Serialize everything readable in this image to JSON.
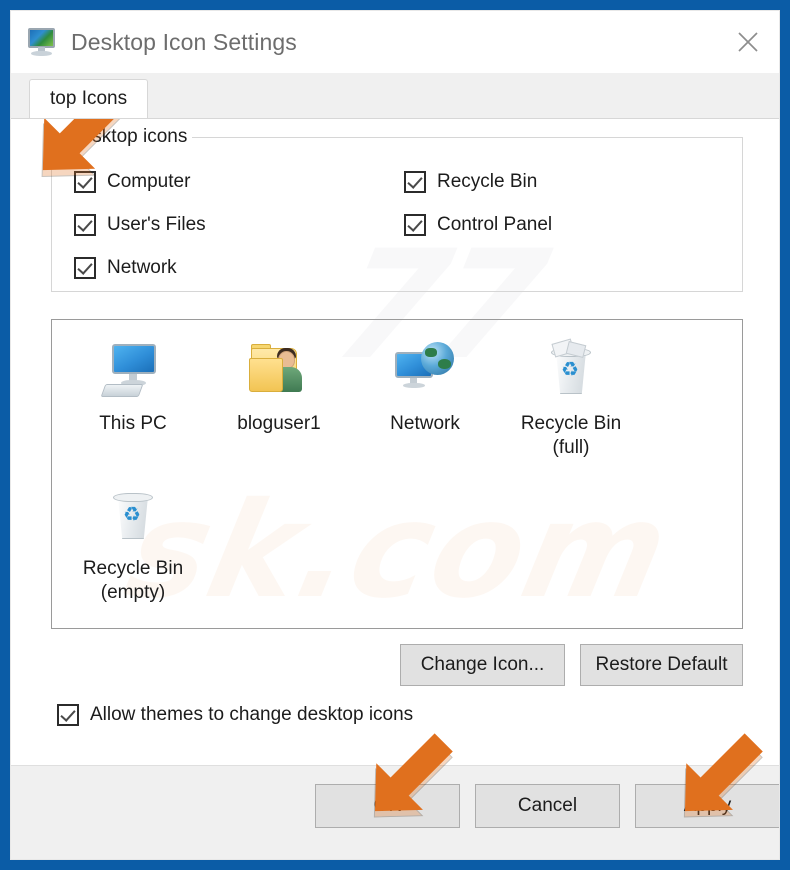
{
  "window": {
    "title": "Desktop Icon Settings",
    "icon": "display-monitor-icon",
    "close_label": "✕",
    "frame_color": "#0b5ca6"
  },
  "tabs": [
    {
      "label": "Desktop Icons",
      "visible_label": "top Icons",
      "selected": true
    }
  ],
  "groupbox": {
    "legend": "Desktop icons",
    "checkboxes": [
      {
        "label": "Computer",
        "checked": true,
        "column": "left"
      },
      {
        "label": "Recycle Bin",
        "checked": true,
        "column": "right"
      },
      {
        "label": "User's Files",
        "checked": true,
        "column": "left"
      },
      {
        "label": "Control Panel",
        "checked": true,
        "column": "right"
      },
      {
        "label": "Network",
        "checked": true,
        "column": "left"
      }
    ]
  },
  "preview": {
    "icons": [
      {
        "caption": "This PC",
        "icon": "computer-monitor-icon"
      },
      {
        "caption": "bloguser1",
        "icon": "user-folder-icon"
      },
      {
        "caption": "Network",
        "icon": "network-globe-icon"
      },
      {
        "caption": "Recycle Bin\n(full)",
        "icon": "recycle-bin-full-icon"
      },
      {
        "caption": "Recycle Bin\n(empty)",
        "icon": "recycle-bin-empty-icon"
      }
    ],
    "recycle_symbol": "♻"
  },
  "buttons": {
    "change_icon": "Change Icon...",
    "restore_default": "Restore Default",
    "ok": "OK",
    "cancel": "Cancel",
    "apply": "Apply"
  },
  "allow_themes": {
    "label": "Allow themes to change desktop icons",
    "checked": true
  },
  "annotations": {
    "arrow_color": "#e0701e",
    "arrows": [
      {
        "target": "desktop-icons-tab"
      },
      {
        "target": "ok-button"
      },
      {
        "target": "apply-button"
      }
    ]
  },
  "watermark": {
    "text_orange": "sk.com",
    "text_gray": "77"
  }
}
